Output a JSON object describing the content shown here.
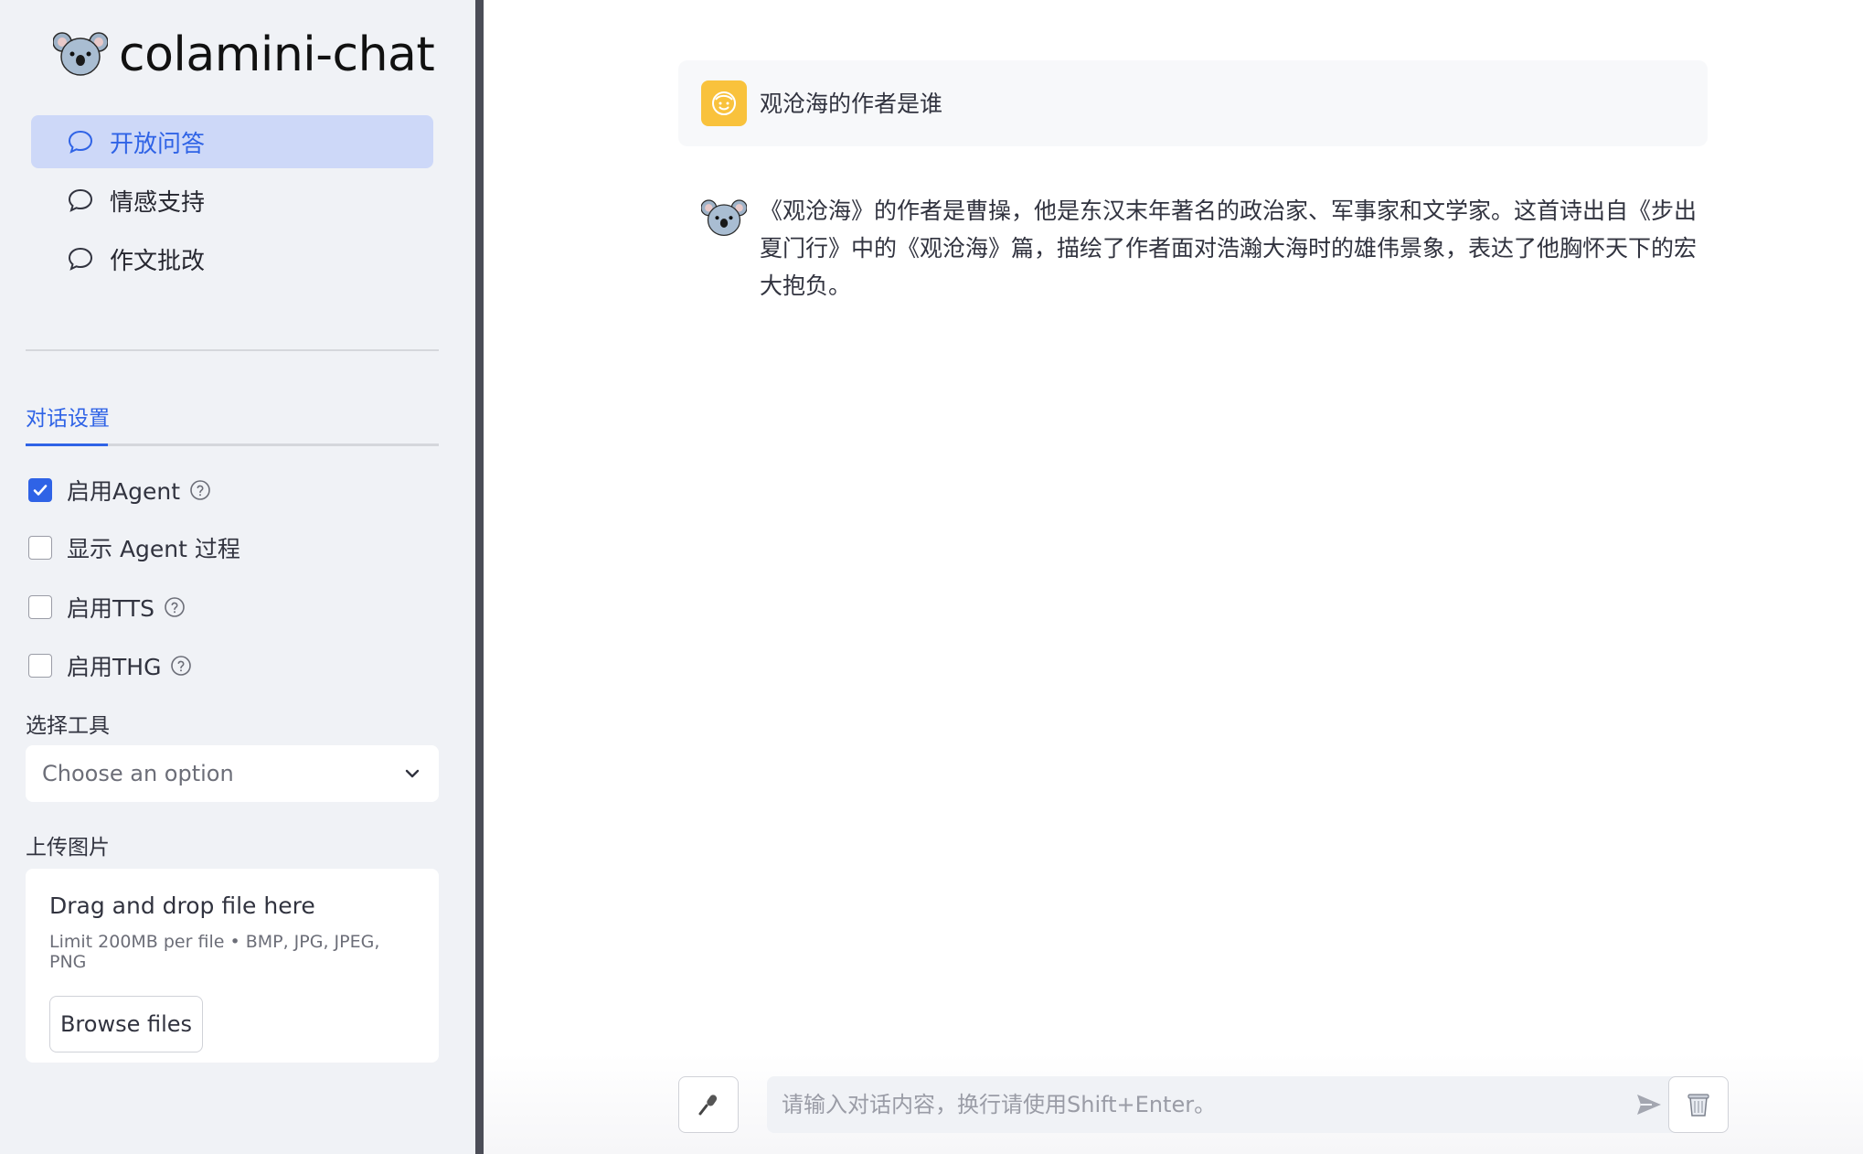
{
  "app": {
    "title": "colamini-chat",
    "logo": "koala-logo-icon"
  },
  "nav": {
    "items": [
      {
        "label": "开放问答",
        "icon": "chat-bubble-icon",
        "active": true
      },
      {
        "label": "情感支持",
        "icon": "chat-bubble-icon",
        "active": false
      },
      {
        "label": "作文批改",
        "icon": "chat-bubble-icon",
        "active": false
      }
    ]
  },
  "settings": {
    "tab_label": "对话设置",
    "options": [
      {
        "label": "启用Agent",
        "checked": true,
        "help": true
      },
      {
        "label": "显示 Agent 过程",
        "checked": false,
        "help": false
      },
      {
        "label": "启用TTS",
        "checked": false,
        "help": true
      },
      {
        "label": "启用THG",
        "checked": false,
        "help": true
      }
    ],
    "tool_label": "选择工具",
    "tool_select_value": "Choose an option",
    "upload_label": "上传图片",
    "upload": {
      "title": "Drag and drop file here",
      "limit": "Limit 200MB per file • BMP, JPG, JPEG, PNG",
      "browse_label": "Browse files"
    }
  },
  "chat": {
    "messages": [
      {
        "role": "user",
        "text": "观沧海的作者是谁"
      },
      {
        "role": "assistant",
        "text": "《观沧海》的作者是曹操，他是东汉末年著名的政治家、军事家和文学家。这首诗出自《步出夏门行》中的《观沧海》篇，描绘了作者面对浩瀚大海时的雄伟景象，表达了他胸怀天下的宏大抱负。"
      }
    ],
    "input_placeholder": "请输入对话内容，换行请使用Shift+Enter。",
    "mic_icon": "microphone-icon",
    "send_icon": "send-icon",
    "clear_icon": "trash-icon"
  },
  "colors": {
    "accent": "#2f63e6",
    "nav_active_bg": "#cdd8f8",
    "sidebar_bg": "#f0f2f6",
    "user_avatar": "#f9c23c"
  }
}
